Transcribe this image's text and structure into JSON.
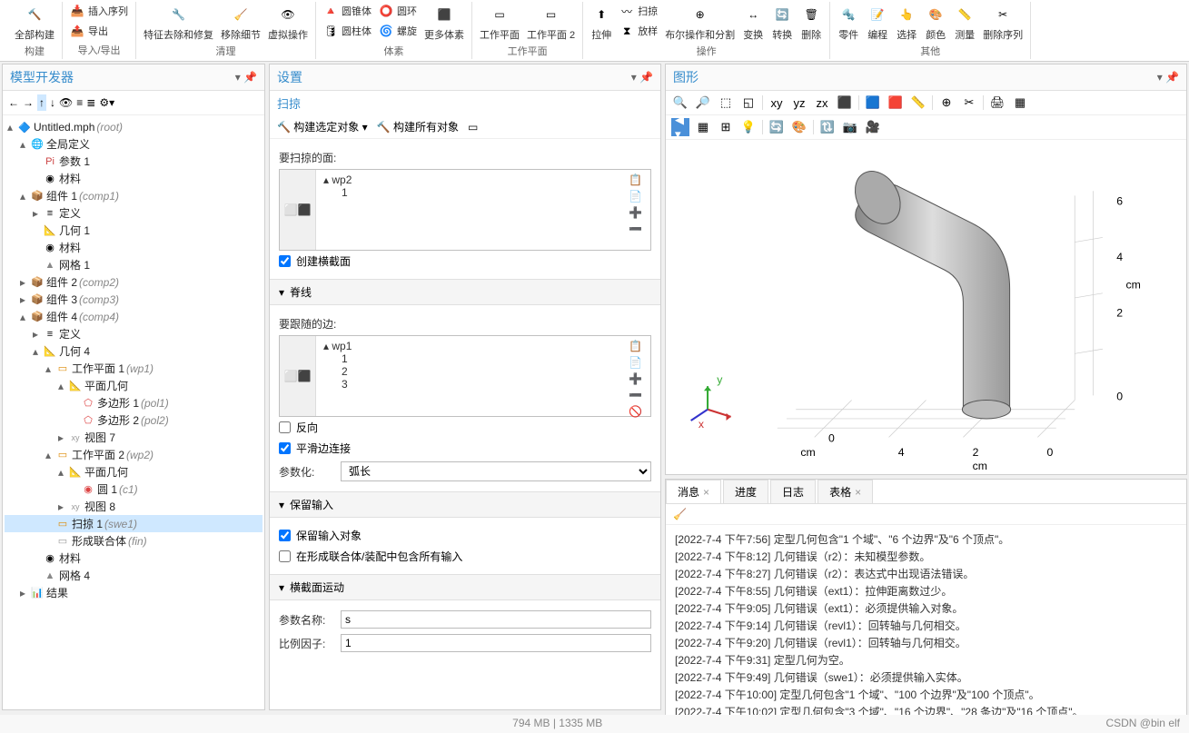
{
  "ribbon": {
    "groups": [
      {
        "label": "构建",
        "items": [
          {
            "icon": "build-all",
            "label": "全部构建"
          }
        ]
      },
      {
        "label": "导入/导出",
        "items": [
          {
            "icon": "insert",
            "label": "插入序列"
          },
          {
            "icon": "export",
            "label": "导出"
          }
        ]
      },
      {
        "label": "清理",
        "items": [
          {
            "icon": "feature-repair",
            "label": "特征去除和修复"
          },
          {
            "icon": "remove-detail",
            "label": "移除细节"
          },
          {
            "icon": "virtual-op",
            "label": "虚拟操作"
          }
        ]
      },
      {
        "label": "体素",
        "items": [
          {
            "icon": "cone",
            "label": "圆锥体"
          },
          {
            "icon": "torus",
            "label": "圆环"
          },
          {
            "icon": "cylinder",
            "label": "圆柱体"
          },
          {
            "icon": "helix",
            "label": "螺旋"
          },
          {
            "icon": "more-prim",
            "label": "更多体素"
          }
        ]
      },
      {
        "label": "工作平面",
        "items": [
          {
            "icon": "workplane",
            "label": "工作平面"
          },
          {
            "icon": "workplane2",
            "label": "工作平面 2"
          }
        ]
      },
      {
        "label": "操作",
        "items": [
          {
            "icon": "extrude",
            "label": "拉伸"
          },
          {
            "icon": "sweep",
            "label": "扫掠"
          },
          {
            "icon": "loft",
            "label": "放样"
          },
          {
            "icon": "bool",
            "label": "布尔操作和分割"
          },
          {
            "icon": "transform",
            "label": "变换"
          },
          {
            "icon": "convert",
            "label": "转换"
          },
          {
            "icon": "delete",
            "label": "删除"
          }
        ]
      },
      {
        "label": "其他",
        "items": [
          {
            "icon": "part",
            "label": "零件"
          },
          {
            "icon": "program",
            "label": "编程"
          },
          {
            "icon": "select",
            "label": "选择"
          },
          {
            "icon": "color",
            "label": "颜色"
          },
          {
            "icon": "measure",
            "label": "测量"
          },
          {
            "icon": "del-seq",
            "label": "删除序列"
          }
        ]
      }
    ]
  },
  "treePanel": {
    "title": "模型开发器"
  },
  "tree": {
    "root": {
      "label": "Untitled.mph",
      "tag": "(root)",
      "icon": "🔷"
    },
    "global": {
      "label": "全局定义",
      "icon": "🌐"
    },
    "params": {
      "label": "参数 1",
      "icon": "Pi"
    },
    "materials": {
      "label": "材料",
      "icon": "◉"
    },
    "comp1": {
      "label": "组件 1",
      "tag": "(comp1)",
      "icon": "📦"
    },
    "comp1_def": {
      "label": "定义",
      "icon": "≡"
    },
    "comp1_geom": {
      "label": "几何 1",
      "icon": "📐"
    },
    "comp1_mat": {
      "label": "材料",
      "icon": "◉"
    },
    "comp1_mesh": {
      "label": "网格 1",
      "icon": "▲"
    },
    "comp2": {
      "label": "组件 2",
      "tag": "(comp2)",
      "icon": "📦"
    },
    "comp3": {
      "label": "组件 3",
      "tag": "(comp3)",
      "icon": "📦"
    },
    "comp4": {
      "label": "组件 4",
      "tag": "(comp4)",
      "icon": "📦"
    },
    "comp4_def": {
      "label": "定义",
      "icon": "≡"
    },
    "comp4_geom": {
      "label": "几何 4",
      "icon": "📐"
    },
    "wp1": {
      "label": "工作平面 1",
      "tag": "(wp1)",
      "icon": "▭"
    },
    "wp1_plane": {
      "label": "平面几何",
      "icon": "📐"
    },
    "poly1": {
      "label": "多边形 1",
      "tag": "(pol1)",
      "icon": "⬠"
    },
    "poly2": {
      "label": "多边形 2",
      "tag": "(pol2)",
      "icon": "⬠"
    },
    "view7": {
      "label": "视图 7",
      "icon": "xy"
    },
    "wp2": {
      "label": "工作平面 2",
      "tag": "(wp2)",
      "icon": "▭"
    },
    "wp2_plane": {
      "label": "平面几何",
      "icon": "📐"
    },
    "circle1": {
      "label": "圆 1",
      "tag": "(c1)",
      "icon": "◉"
    },
    "view8": {
      "label": "视图 8",
      "icon": "xy"
    },
    "sweep1": {
      "label": "扫掠 1",
      "tag": "(swe1)",
      "icon": "▭"
    },
    "union": {
      "label": "形成联合体",
      "tag": "(fin)",
      "icon": "▭"
    },
    "comp4_mat": {
      "label": "材料",
      "icon": "◉"
    },
    "comp4_mesh": {
      "label": "网格 4",
      "icon": "▲"
    },
    "results": {
      "label": "结果",
      "icon": "📊"
    }
  },
  "settings": {
    "title": "设置",
    "subtitle": "扫掠",
    "build_sel": "构建选定对象",
    "build_all": "构建所有对象",
    "sec_faces": "要扫掠的面:",
    "face_item": "wp2",
    "face_sub": "1",
    "chk_cross": "创建横截面",
    "sec_spine": "脊线",
    "sec_edges": "要跟随的边:",
    "edge_item": "wp1",
    "edge_sub1": "1",
    "edge_sub2": "2",
    "edge_sub3": "3",
    "chk_reverse": "反向",
    "chk_smooth": "平滑边连接",
    "param_label": "参数化:",
    "param_value": "弧长",
    "sec_keep": "保留输入",
    "chk_keepinput": "保留输入对象",
    "chk_include": "在形成联合体/装配中包含所有输入",
    "sec_motion": "横截面运动",
    "paramname_label": "参数名称:",
    "paramname_value": "s",
    "scale_label": "比例因子:",
    "scale_value": "1"
  },
  "graphics": {
    "title": "图形",
    "unit": "cm",
    "x_label": "x",
    "y_label": "y",
    "axis_ticks": [
      "0",
      "2",
      "4",
      "6"
    ],
    "x_ticks": [
      "0",
      "2",
      "4"
    ]
  },
  "tabs": {
    "msg": "消息",
    "progress": "进度",
    "log": "日志",
    "table": "表格"
  },
  "messages": [
    "[2022-7-4 下午7:56] 定型几何包含\"1 个域\"、\"6 个边界\"及\"6 个顶点\"。",
    "[2022-7-4 下午8:12] 几何错误（r2）：未知模型参数。",
    "[2022-7-4 下午8:27] 几何错误（r2）：表达式中出现语法错误。",
    "[2022-7-4 下午8:55] 几何错误（ext1）：拉伸距离数过少。",
    "[2022-7-4 下午9:05] 几何错误（ext1）：必须提供输入对象。",
    "[2022-7-4 下午9:14] 几何错误（revl1）：回转轴与几何相交。",
    "[2022-7-4 下午9:20] 几何错误（revl1）：回转轴与几何相交。",
    "[2022-7-4 下午9:31] 定型几何为空。",
    "[2022-7-4 下午9:49] 几何错误（swe1）：必须提供输入实体。",
    "[2022-7-4 下午10:00] 定型几何包含\"1 个域\"、\"100 个边界\"及\"100 个顶点\"。",
    "[2022-7-4 下午10:02] 定型几何包含\"3 个域\"、\"16 个边界\"、\"28 条边\"及\"16 个顶点\"。"
  ],
  "status": {
    "mem": "794 MB | 1335 MB",
    "credit": "CSDN @bin elf"
  }
}
